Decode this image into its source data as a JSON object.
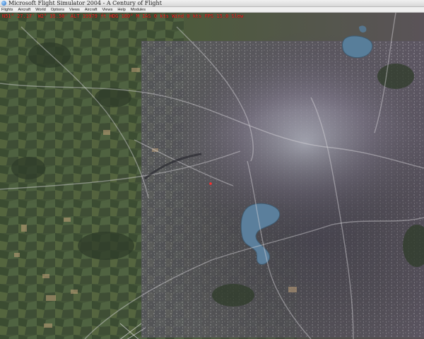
{
  "window": {
    "title": "Microsoft Flight Simulator 2004 - A Century of Flight"
  },
  "menubar": {
    "items": [
      "Flights",
      "Aircraft",
      "World",
      "Options",
      "Views",
      "Aircraft",
      "Views",
      "Help",
      "Modules"
    ]
  },
  "status": {
    "text": "N51° 27.17' W2° 35.50'  ALT 19979 ft  HDG 180° M  IAS 0 kts  Wind 0 kts  FPS 15.0  Slew"
  },
  "icons": {
    "app": "app-icon"
  }
}
